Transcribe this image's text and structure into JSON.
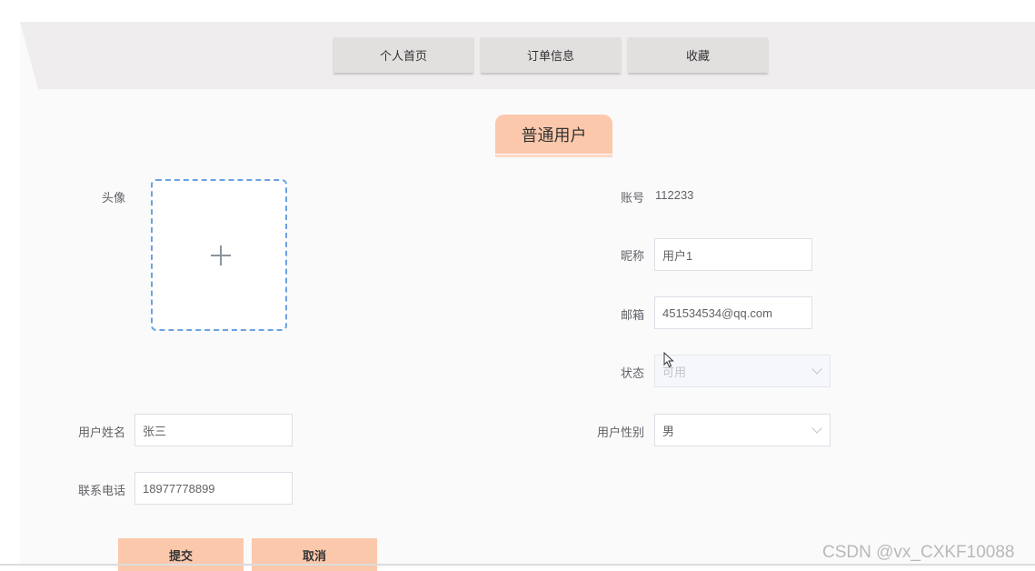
{
  "nav": {
    "items": [
      {
        "label": "个人首页"
      },
      {
        "label": "订单信息"
      },
      {
        "label": "收藏"
      }
    ]
  },
  "section_title": "普通用户",
  "form": {
    "avatar_label": "头像",
    "account_label": "账号",
    "account_value": "112233",
    "nickname_label": "昵称",
    "nickname_value": "用户1",
    "email_label": "邮箱",
    "email_value": "451534534@qq.com",
    "status_label": "状态",
    "status_value": "可用",
    "name_label": "用户姓名",
    "name_value": "张三",
    "gender_label": "用户性别",
    "gender_value": "男",
    "phone_label": "联系电话",
    "phone_value": "18977778899"
  },
  "actions": {
    "submit_label": "提交",
    "cancel_label": "取消"
  },
  "watermark": "CSDN @vx_CXKF10088",
  "colors": {
    "accent": "#fcc8ac",
    "nav_button": "#e2dfdf",
    "header_band": "#efeded",
    "upload_border": "#6aa2e4"
  }
}
